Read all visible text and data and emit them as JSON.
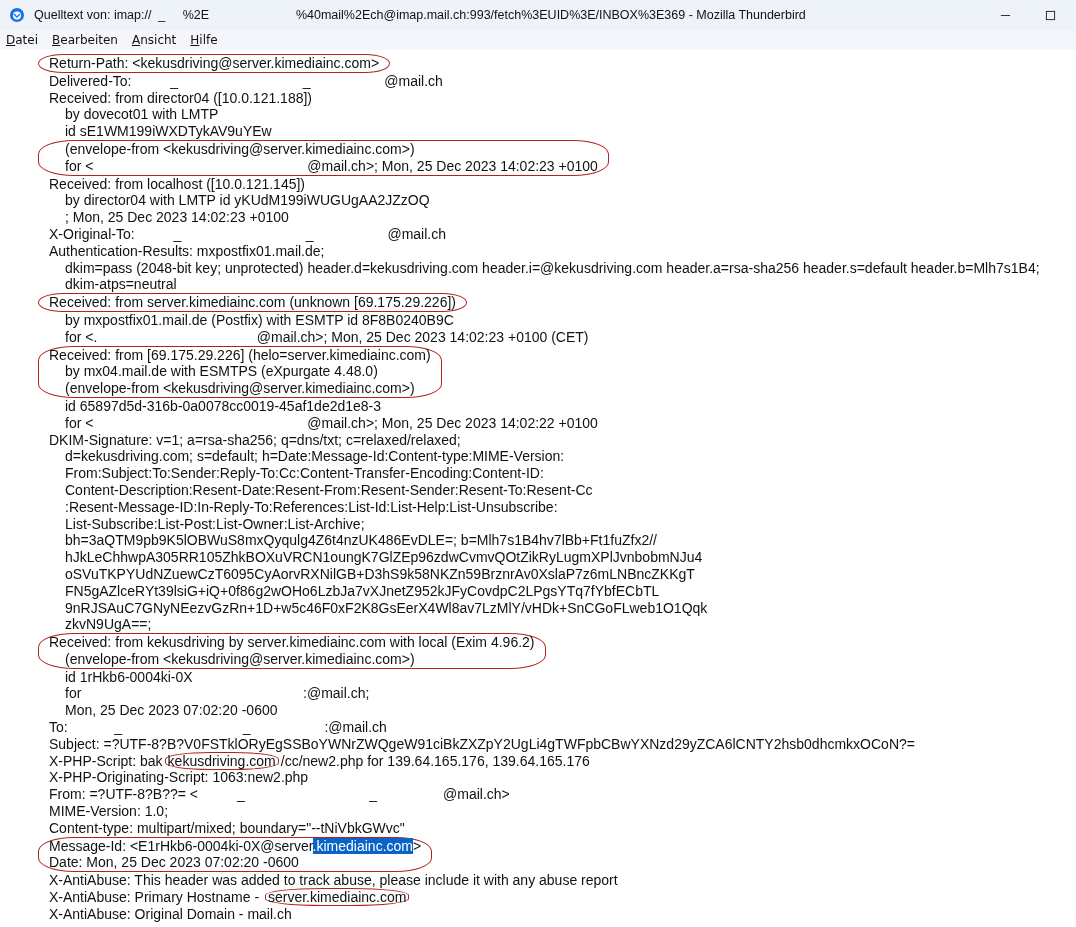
{
  "window": {
    "title": "Quelltext von: imap://  _     %2E                         %40mail%2Ech@imap.mail.ch:993/fetch%3EUID%3E/INBOX%3E369 - Mozilla Thunderbird"
  },
  "menu": [
    "Datei",
    "Bearbeiten",
    "Ansicht",
    "Hilfe"
  ],
  "source": [
    {
      "circled": true,
      "lines": [
        {
          "indent": false,
          "parts": [
            {
              "text": "Return-Path: <kekusdriving@server.kimediainc.com>"
            }
          ]
        }
      ]
    },
    {
      "circled": false,
      "lines": [
        {
          "indent": false,
          "parts": [
            {
              "text": "Delivered-To:          _                                _                   @mail.ch"
            }
          ]
        },
        {
          "indent": false,
          "parts": [
            {
              "text": "Received: from director04 ([10.0.121.188])"
            }
          ]
        },
        {
          "indent": true,
          "parts": [
            {
              "text": "by dovecot01 with LMTP"
            }
          ]
        },
        {
          "indent": true,
          "parts": [
            {
              "text": "id sE1WM199iWXDTykAV9uYEw"
            }
          ]
        }
      ]
    },
    {
      "circled": true,
      "lines": [
        {
          "indent": true,
          "parts": [
            {
              "text": "(envelope-from <kekusdriving@server.kimediainc.com>)"
            }
          ]
        },
        {
          "indent": true,
          "parts": [
            {
              "text": "for <                                                       @mail.ch>; Mon, 25 Dec 2023 14:02:23 +0100"
            }
          ]
        }
      ]
    },
    {
      "circled": false,
      "lines": [
        {
          "indent": false,
          "parts": [
            {
              "text": "Received: from localhost ([10.0.121.145])"
            }
          ]
        },
        {
          "indent": true,
          "parts": [
            {
              "text": "by director04 with LMTP id yKUdM199iWUGUgAA2JZzOQ"
            }
          ]
        },
        {
          "indent": true,
          "parts": [
            {
              "text": "; Mon, 25 Dec 2023 14:02:23 +0100"
            }
          ]
        },
        {
          "indent": false,
          "parts": [
            {
              "text": "X-Original-To:          _                                _                   @mail.ch"
            }
          ]
        },
        {
          "indent": false,
          "parts": [
            {
              "text": "Authentication-Results: mxpostfix01.mail.de;"
            }
          ]
        },
        {
          "indent": true,
          "parts": [
            {
              "text": "dkim=pass (2048-bit key; unprotected) header.d=kekusdriving.com header.i=@kekusdriving.com header.a=rsa-sha256 header.s=default header.b=Mlh7s1B4;"
            }
          ]
        },
        {
          "indent": true,
          "parts": [
            {
              "text": "dkim-atps=neutral"
            }
          ]
        }
      ]
    },
    {
      "circled": true,
      "lines": [
        {
          "indent": false,
          "parts": [
            {
              "text": "Received: from server.kimediainc.com (unknown [69.175.29.226])"
            }
          ]
        }
      ]
    },
    {
      "circled": false,
      "lines": [
        {
          "indent": true,
          "parts": [
            {
              "text": "by mxpostfix01.mail.de (Postfix) with ESMTP id 8F8B0240B9C"
            }
          ]
        },
        {
          "indent": true,
          "parts": [
            {
              "text": "for <.                                         @mail.ch>; Mon, 25 Dec 2023 14:02:23 +0100 (CET)"
            }
          ]
        }
      ]
    },
    {
      "circled": true,
      "lines": [
        {
          "indent": false,
          "parts": [
            {
              "text": "Received: from [69.175.29.226] (helo=server.kimediainc.com)"
            }
          ]
        },
        {
          "indent": true,
          "parts": [
            {
              "text": "by mx04.mail.de with ESMTPS (eXpurgate 4.48.0)"
            }
          ]
        },
        {
          "indent": true,
          "parts": [
            {
              "text": "(envelope-from <kekusdriving@server.kimediainc.com>)"
            }
          ]
        }
      ]
    },
    {
      "circled": false,
      "lines": [
        {
          "indent": true,
          "parts": [
            {
              "text": "id 65897d5d-316b-0a0078cc0019-45af1de2d1e8-3"
            }
          ]
        },
        {
          "indent": true,
          "parts": [
            {
              "text": "for <                                                       @mail.ch>; Mon, 25 Dec 2023 14:02:22 +0100"
            }
          ]
        },
        {
          "indent": false,
          "parts": [
            {
              "text": "DKIM-Signature: v=1; a=rsa-sha256; q=dns/txt; c=relaxed/relaxed;"
            }
          ]
        },
        {
          "indent": true,
          "parts": [
            {
              "text": "d=kekusdriving.com; s=default; h=Date:Message-Id:Content-type:MIME-Version:"
            }
          ]
        },
        {
          "indent": true,
          "parts": [
            {
              "text": "From:Subject:To:Sender:Reply-To:Cc:Content-Transfer-Encoding:Content-ID:"
            }
          ]
        },
        {
          "indent": true,
          "parts": [
            {
              "text": "Content-Description:Resent-Date:Resent-From:Resent-Sender:Resent-To:Resent-Cc"
            }
          ]
        },
        {
          "indent": true,
          "parts": [
            {
              "text": ":Resent-Message-ID:In-Reply-To:References:List-Id:List-Help:List-Unsubscribe:"
            }
          ]
        },
        {
          "indent": true,
          "parts": [
            {
              "text": "List-Subscribe:List-Post:List-Owner:List-Archive;"
            }
          ]
        },
        {
          "indent": true,
          "parts": [
            {
              "text": "bh=3aQTM9pb9K5lOBWuS8mxQyqulg4Z6t4nzUK486EvDLE=; b=Mlh7s1B4hv7lBb+Ft1fuZfx2//"
            }
          ]
        },
        {
          "indent": true,
          "parts": [
            {
              "text": "hJkLeChhwpA305RR105ZhkBOXuVRCN1oungK7GlZEp96zdwCvmvQOtZikRyLugmXPlJvnbobmNJu4"
            }
          ]
        },
        {
          "indent": true,
          "parts": [
            {
              "text": "oSVuTKPYUdNZuewCzT6095CyAorvRXNilGB+D3hS9k58NKZn59BrznrAv0XslaP7z6mLNBncZKKgT"
            }
          ]
        },
        {
          "indent": true,
          "parts": [
            {
              "text": "FN5gAZlceRYt39lsiG+iQ+0f86g2wOHo6LzbJa7vXJnetZ952kJFyCovdpC2LPgsYTq7fYbfECbTL"
            }
          ]
        },
        {
          "indent": true,
          "parts": [
            {
              "text": "9nRJSAuC7GNyNEezvGzRn+1D+w5c46F0xF2K8GsEerX4Wl8av7LzMlY/vHDk+SnCGoFLweb1O1Qqk"
            }
          ]
        },
        {
          "indent": true,
          "parts": [
            {
              "text": "zkvN9UgA==;"
            }
          ]
        }
      ]
    },
    {
      "circled": true,
      "lines": [
        {
          "indent": false,
          "parts": [
            {
              "text": "Received: from kekusdriving by server.kimediainc.com with local (Exim 4.96.2)"
            }
          ]
        },
        {
          "indent": true,
          "parts": [
            {
              "text": "(envelope-from <kekusdriving@server.kimediainc.com>)"
            }
          ]
        }
      ]
    },
    {
      "circled": false,
      "lines": [
        {
          "indent": true,
          "parts": [
            {
              "text": "id 1rHkb6-0004ki-0X"
            }
          ]
        },
        {
          "indent": true,
          "parts": [
            {
              "text": "for                                                         :@mail.ch;"
            }
          ]
        },
        {
          "indent": true,
          "parts": [
            {
              "text": "Mon, 25 Dec 2023 07:02:20 -0600"
            }
          ]
        },
        {
          "indent": false,
          "parts": [
            {
              "text": "To:            _                               _                   :@mail.ch"
            }
          ]
        },
        {
          "indent": false,
          "parts": [
            {
              "text": "Subject: =?UTF-8?B?V0FSTklORyEgSSBoYWNrZWQgeW91ciBkZXZpY2UgLi4gTWFpbCBwYXNzd29yZCA6lCNTY2hsb0dhcmkxOCoN?="
            }
          ]
        },
        {
          "indent": false,
          "parts": [
            {
              "text": "X-PHP-Script: bak"
            },
            {
              "text": "kekusdriving.com",
              "circled": true
            },
            {
              "text": "/cc/new2.php for 139.64.165.176, 139.64.165.176"
            }
          ]
        },
        {
          "indent": false,
          "parts": [
            {
              "text": "X-PHP-Originating-Script: 1063:new2.php"
            }
          ]
        },
        {
          "indent": false,
          "parts": [
            {
              "text": "From: =?UTF-8?B??= <          _                                _                 @mail.ch>"
            }
          ]
        },
        {
          "indent": false,
          "parts": [
            {
              "text": "MIME-Version: 1.0;"
            }
          ]
        },
        {
          "indent": false,
          "parts": [
            {
              "text": "Content-type: multipart/mixed; boundary=\"--tNiVbkGWvc\""
            }
          ]
        }
      ]
    },
    {
      "circled": true,
      "lines": [
        {
          "indent": false,
          "parts": [
            {
              "text": "Message-Id: <E1rHkb6-0004ki-0X@server"
            },
            {
              "text": ".kimediainc.com",
              "highlighted": true
            },
            {
              "text": ">"
            }
          ]
        },
        {
          "indent": false,
          "parts": [
            {
              "text": "Date: Mon, 25 Dec 2023 07:02:20 -0600"
            }
          ]
        }
      ]
    },
    {
      "circled": false,
      "lines": [
        {
          "indent": false,
          "parts": [
            {
              "text": "X-AntiAbuse: This header was added to track abuse, please include it with any abuse report"
            }
          ]
        },
        {
          "indent": false,
          "parts": [
            {
              "text": "X-AntiAbuse: Primary Hostname - "
            },
            {
              "text": "server.kimediainc.com",
              "circled": true
            }
          ]
        },
        {
          "indent": false,
          "parts": [
            {
              "text": "X-AntiAbuse: Original Domain - mail.ch"
            }
          ]
        }
      ]
    }
  ]
}
